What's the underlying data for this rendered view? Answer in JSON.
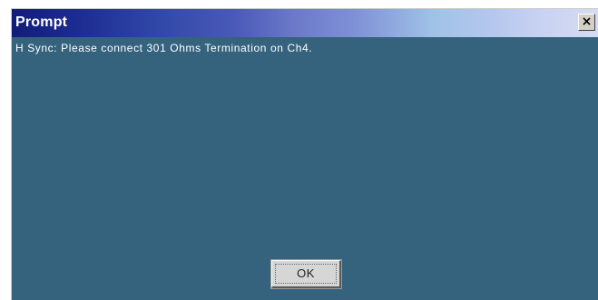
{
  "dialog": {
    "title": "Prompt",
    "close_glyph": "×",
    "close_icon": "close-icon",
    "message": "H Sync: Please connect 301 Ohms Termination on Ch4.",
    "ok_label": "OK"
  },
  "colors": {
    "dialog_background": "#35637e",
    "titlebar_start": "#121c7a",
    "titlebar_end": "#d5dbf2",
    "button_face": "#d6d6d6"
  }
}
